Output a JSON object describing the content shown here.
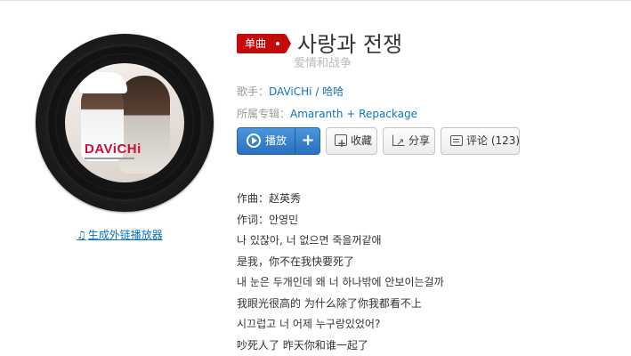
{
  "badge": {
    "label": "单曲"
  },
  "song": {
    "title": "사랑과 전쟁",
    "subtitle": "爱情和战争"
  },
  "meta": {
    "singer_label": "歌手：",
    "singer_1": "DAViCHi",
    "singer_sep": " / ",
    "singer_2": "哈哈",
    "album_label": "所属专辑：",
    "album": "Amaranth + Repackage"
  },
  "buttons": {
    "play": "播放",
    "plus": "+",
    "collect": "收藏",
    "share": "分享",
    "comment": "评论 (123)"
  },
  "cover": {
    "logo_text": "DAViCHi"
  },
  "ext_link": {
    "label": "生成外链播放器"
  },
  "lyrics": [
    "作曲：赵英秀",
    "作词：안영민",
    "나 있잖아, 너 없으면 죽을꺼같애",
    "是我，你不在我快要死了",
    "내 눈은 두개인데 왜 너 하나밖에 안보이는걸까",
    "我眼光很高的 为什么除了你我都看不上",
    "시끄럽고 너 어제 누구랑있었어?",
    "吵死人了 昨天你和谁一起了"
  ],
  "colors": {
    "accent_red": "#c20c0c",
    "link_blue": "#0c73c2",
    "play_blue": "#2a6fbf"
  }
}
